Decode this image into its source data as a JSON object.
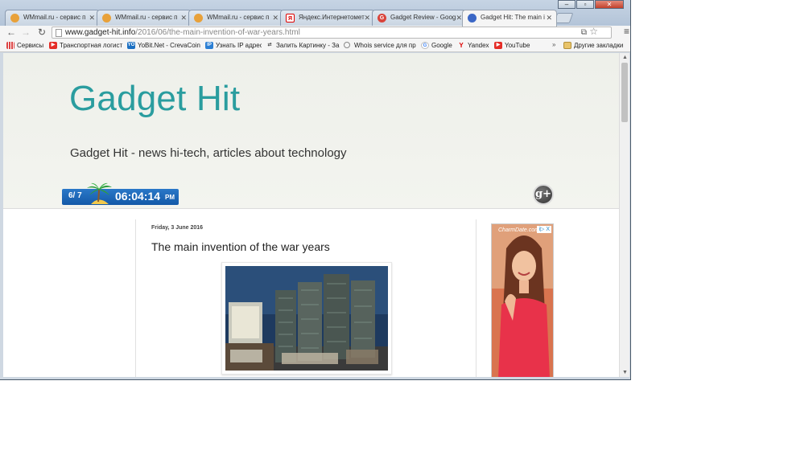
{
  "browser": {
    "tabs": [
      {
        "label": "WMmail.ru - сервис п",
        "icon": "wmmail-favicon"
      },
      {
        "label": "WMmail.ru - сервис п",
        "icon": "wmmail-favicon"
      },
      {
        "label": "WMmail.ru - сервис п",
        "icon": "wmmail-favicon"
      },
      {
        "label": "Яндекс.Интернетомет",
        "icon": "yandex-favicon"
      },
      {
        "label": "Gadget Review - Goog",
        "icon": "google-favicon"
      },
      {
        "label": "Gadget Hit: The main i",
        "icon": "gadget-hit-favicon",
        "active": true
      }
    ],
    "address": {
      "host": "www.gadget-hit.info",
      "path": "/2016/06/the-main-invention-of-war-years.html"
    },
    "bookmarks": [
      {
        "label": "Сервисы",
        "icon": "apps-icon"
      },
      {
        "label": "Транспортная логист",
        "icon": "youtube-icon"
      },
      {
        "label": "YoBit.Net - CrevaCoin",
        "icon": "yobit-icon"
      },
      {
        "label": "Узнать IP адрес",
        "icon": "ip-icon"
      },
      {
        "label": "Залить Картинку - За",
        "icon": "upload-icon"
      },
      {
        "label": "Whois service для пр",
        "icon": "whois-icon"
      },
      {
        "label": "Google",
        "icon": "google-icon"
      },
      {
        "label": "Yandex",
        "icon": "yandex-icon"
      },
      {
        "label": "YouTube",
        "icon": "youtube-icon"
      },
      {
        "label": "Другие закладки",
        "icon": "folder-icon"
      }
    ],
    "bookmarks_more": "»"
  },
  "page": {
    "blog_title": "Gadget Hit",
    "blog_description": "Gadget Hit - news hi-tech, articles about technology",
    "clock": {
      "date": "6/ 7",
      "time": "06:04:14",
      "ampm": "PM"
    },
    "post": {
      "date": "Friday, 3 June 2016",
      "title": "The main invention of the war years"
    },
    "ad": {
      "choices_label": "i▷ X",
      "logo": "CharmDate.com"
    }
  },
  "colors": {
    "title_teal": "#2a9d9f",
    "clock_blue": "#1359a8",
    "header_bg": "#eef0ea"
  }
}
